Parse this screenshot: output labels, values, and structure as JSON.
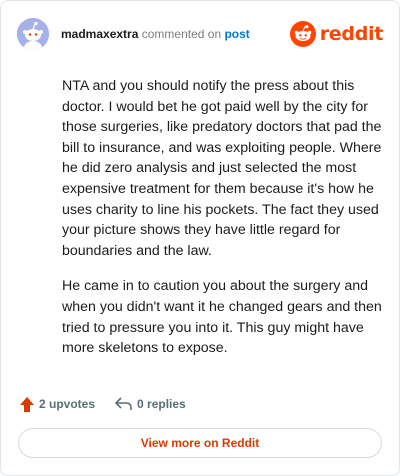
{
  "header": {
    "username": "madmaxextra",
    "action_text": "commented on",
    "target_link": "post",
    "brand_name": "reddit",
    "brand_color": "#ff4500",
    "avatar_icon": "snoo-avatar-icon",
    "logo_icon": "reddit-snoo-icon"
  },
  "comment": {
    "paragraphs": [
      "NTA and you should notify the press about this doctor. I would bet he got paid well by the city for those surgeries, like predatory doctors that pad the bill to insurance, and was exploiting people. Where he did zero analysis and just selected the most expensive treatment for them because it's how he uses charity to line his pockets. The fact they used your picture shows they have little regard for boundaries and the law.",
      "He came in to caution you about the surgery and when you didn't want it he changed gears and then tried to pressure you into it. This guy might have more skeletons to expose."
    ]
  },
  "footer": {
    "upvotes": "2 upvotes",
    "replies": "0 replies",
    "upvote_icon": "upvote-arrow-icon",
    "reply_icon": "reply-arrow-icon",
    "upvote_color": "#d93a00"
  },
  "cta": {
    "label": "View more on Reddit"
  }
}
